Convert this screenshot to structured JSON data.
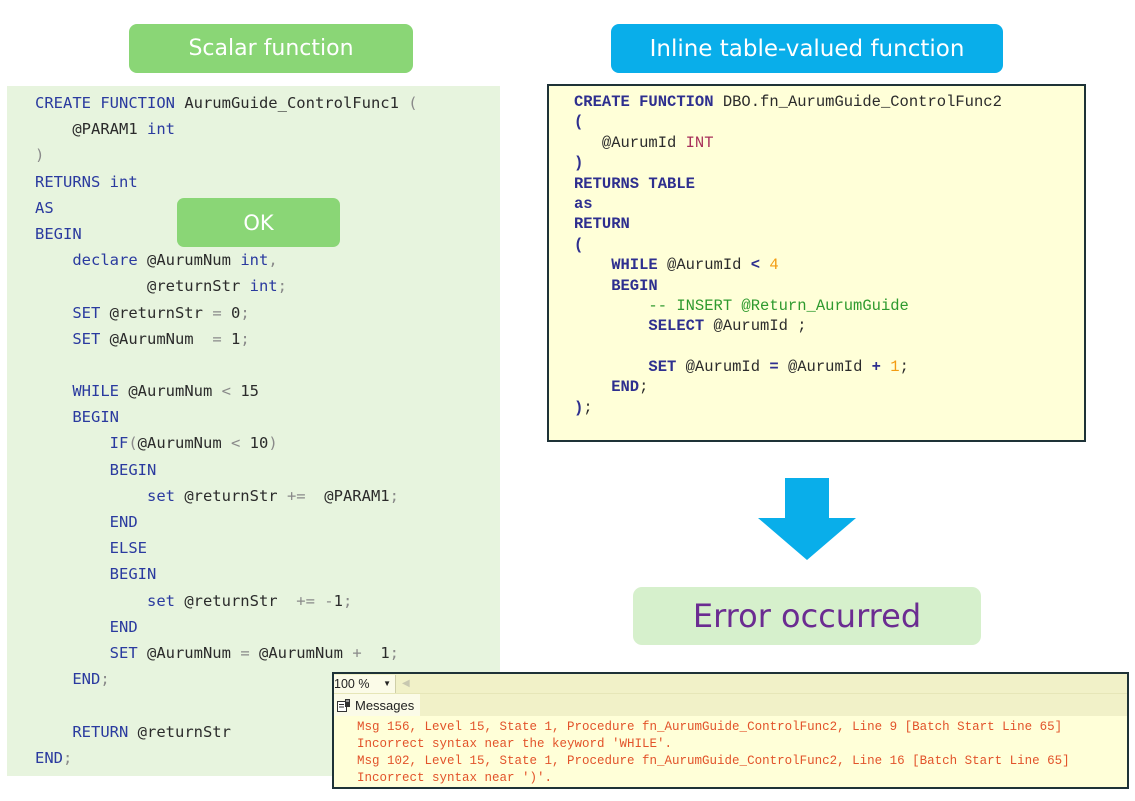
{
  "scalar": {
    "title": "Scalar function",
    "ok_label": "OK",
    "code_lines": [
      [
        {
          "t": "CREATE FUNCTION ",
          "c": "kw"
        },
        {
          "t": "AurumGuide_ControlFunc1 ",
          "c": ""
        },
        {
          "t": "(",
          "c": "op"
        }
      ],
      [
        {
          "t": "    @PARAM1 ",
          "c": ""
        },
        {
          "t": "int",
          "c": "kw"
        }
      ],
      [
        {
          "t": ")",
          "c": "op"
        }
      ],
      [
        {
          "t": "RETURNS int",
          "c": "kw"
        }
      ],
      [
        {
          "t": "AS",
          "c": "kw"
        }
      ],
      [
        {
          "t": "BEGIN",
          "c": "kw"
        }
      ],
      [
        {
          "t": "    declare ",
          "c": "kw"
        },
        {
          "t": "@AurumNum ",
          "c": ""
        },
        {
          "t": "int",
          "c": "kw"
        },
        {
          "t": ",",
          "c": "op"
        }
      ],
      [
        {
          "t": "            @returnStr ",
          "c": ""
        },
        {
          "t": "int",
          "c": "kw"
        },
        {
          "t": ";",
          "c": "op"
        }
      ],
      [
        {
          "t": "    SET ",
          "c": "kw"
        },
        {
          "t": "@returnStr ",
          "c": ""
        },
        {
          "t": "= ",
          "c": "op"
        },
        {
          "t": "0",
          "c": ""
        },
        {
          "t": ";",
          "c": "op"
        }
      ],
      [
        {
          "t": "    SET ",
          "c": "kw"
        },
        {
          "t": "@AurumNum  ",
          "c": ""
        },
        {
          "t": "= ",
          "c": "op"
        },
        {
          "t": "1",
          "c": ""
        },
        {
          "t": ";",
          "c": "op"
        }
      ],
      [
        {
          "t": "",
          "c": ""
        }
      ],
      [
        {
          "t": "    WHILE ",
          "c": "kw"
        },
        {
          "t": "@AurumNum ",
          "c": ""
        },
        {
          "t": "< ",
          "c": "op"
        },
        {
          "t": "15",
          "c": ""
        }
      ],
      [
        {
          "t": "    BEGIN",
          "c": "kw"
        }
      ],
      [
        {
          "t": "        IF",
          "c": "kw"
        },
        {
          "t": "(",
          "c": "op"
        },
        {
          "t": "@AurumNum ",
          "c": ""
        },
        {
          "t": "< ",
          "c": "op"
        },
        {
          "t": "10",
          "c": ""
        },
        {
          "t": ")",
          "c": "op"
        }
      ],
      [
        {
          "t": "        BEGIN",
          "c": "kw"
        }
      ],
      [
        {
          "t": "            set ",
          "c": "kw"
        },
        {
          "t": "@returnStr ",
          "c": ""
        },
        {
          "t": "+=  ",
          "c": "op"
        },
        {
          "t": "@PARAM1",
          "c": ""
        },
        {
          "t": ";",
          "c": "op"
        }
      ],
      [
        {
          "t": "        END",
          "c": "kw"
        }
      ],
      [
        {
          "t": "        ELSE",
          "c": "kw"
        }
      ],
      [
        {
          "t": "        BEGIN",
          "c": "kw"
        }
      ],
      [
        {
          "t": "            set ",
          "c": "kw"
        },
        {
          "t": "@returnStr  ",
          "c": ""
        },
        {
          "t": "+= -",
          "c": "op"
        },
        {
          "t": "1",
          "c": ""
        },
        {
          "t": ";",
          "c": "op"
        }
      ],
      [
        {
          "t": "        END",
          "c": "kw"
        }
      ],
      [
        {
          "t": "        SET ",
          "c": "kw"
        },
        {
          "t": "@AurumNum ",
          "c": ""
        },
        {
          "t": "= ",
          "c": "op"
        },
        {
          "t": "@AurumNum ",
          "c": ""
        },
        {
          "t": "+  ",
          "c": "op"
        },
        {
          "t": "1",
          "c": ""
        },
        {
          "t": ";",
          "c": "op"
        }
      ],
      [
        {
          "t": "    END",
          "c": "kw"
        },
        {
          "t": ";",
          "c": "op"
        }
      ],
      [
        {
          "t": "",
          "c": ""
        }
      ],
      [
        {
          "t": "    RETURN ",
          "c": "kw"
        },
        {
          "t": "@returnStr",
          "c": ""
        }
      ],
      [
        {
          "t": "END",
          "c": "kw"
        },
        {
          "t": ";",
          "c": "op"
        }
      ]
    ]
  },
  "inline": {
    "title": "Inline table-valued function",
    "code_lines": [
      [
        {
          "t": "CREATE FUNCTION ",
          "c": "kw2"
        },
        {
          "t": "DBO.fn_AurumGuide_ControlFunc2",
          "c": ""
        }
      ],
      [
        {
          "t": "(",
          "c": "kw2"
        }
      ],
      [
        {
          "t": "   @AurumId ",
          "c": ""
        },
        {
          "t": "INT",
          "c": "type2"
        }
      ],
      [
        {
          "t": ")",
          "c": "kw2"
        }
      ],
      [
        {
          "t": "RETURNS TABLE",
          "c": "kw2"
        }
      ],
      [
        {
          "t": "as",
          "c": "kw2"
        }
      ],
      [
        {
          "t": "RETURN",
          "c": "kw2"
        }
      ],
      [
        {
          "t": "(",
          "c": "kw2"
        }
      ],
      [
        {
          "t": "    WHILE ",
          "c": "kw2"
        },
        {
          "t": "@AurumId ",
          "c": ""
        },
        {
          "t": "< ",
          "c": "kw2"
        },
        {
          "t": "4",
          "c": "num2"
        }
      ],
      [
        {
          "t": "    BEGIN",
          "c": "kw2"
        }
      ],
      [
        {
          "t": "        -- INSERT @Return_AurumGuide",
          "c": "cmt2"
        }
      ],
      [
        {
          "t": "        SELECT ",
          "c": "kw2"
        },
        {
          "t": "@AurumId ;",
          "c": ""
        }
      ],
      [
        {
          "t": "",
          "c": ""
        }
      ],
      [
        {
          "t": "        SET ",
          "c": "kw2"
        },
        {
          "t": "@AurumId ",
          "c": ""
        },
        {
          "t": "= ",
          "c": "kw2"
        },
        {
          "t": "@AurumId ",
          "c": ""
        },
        {
          "t": "+ ",
          "c": "kw2"
        },
        {
          "t": "1",
          "c": "num2"
        },
        {
          "t": ";",
          "c": ""
        }
      ],
      [
        {
          "t": "    END",
          "c": "kw2"
        },
        {
          "t": ";",
          "c": ""
        }
      ],
      [
        {
          "t": ")",
          "c": "kw2"
        },
        {
          "t": ";",
          "c": ""
        }
      ]
    ]
  },
  "arrow": {
    "icon": "down-arrow-icon",
    "color": "#09aeea"
  },
  "error_label": "Error occurred",
  "messages_panel": {
    "zoom_value": "100 %",
    "tab_label": "Messages",
    "messages": [
      "Msg 156, Level 15, State 1, Procedure fn_AurumGuide_ControlFunc2, Line 9 [Batch Start Line 65]",
      "Incorrect syntax near the keyword 'WHILE'.",
      "Msg 102, Level 15, State 1, Procedure fn_AurumGuide_ControlFunc2, Line 16 [Batch Start Line 65]",
      "Incorrect syntax near ')'."
    ]
  },
  "colors": {
    "scalar_accent": "#8ad676",
    "inline_accent": "#09aeea",
    "error_text": "#6b2c91",
    "message_text": "#e2532a"
  }
}
